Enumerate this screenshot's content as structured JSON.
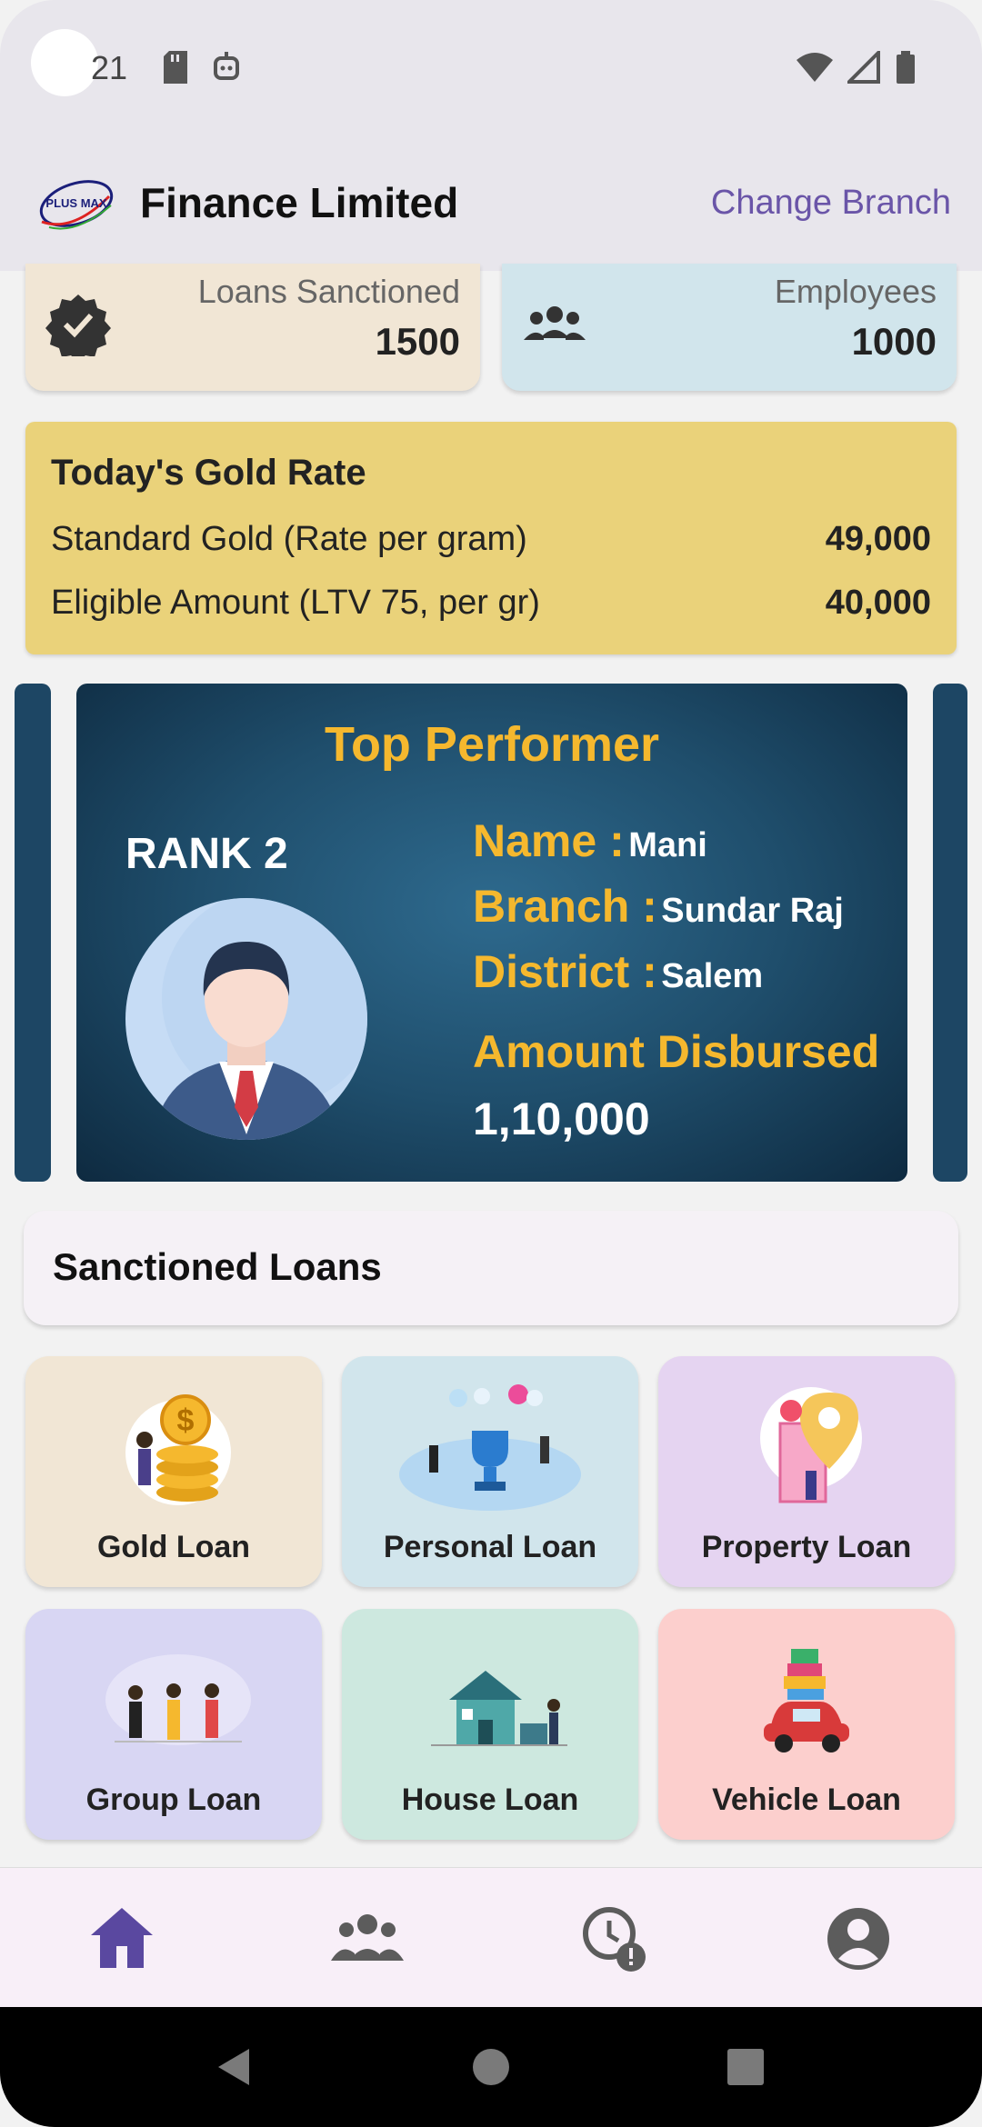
{
  "status_bar": {
    "time": "21"
  },
  "app_bar": {
    "title": "Finance Limited",
    "logo_text": "PLUS MAX",
    "change_branch": "Change Branch"
  },
  "stats": [
    {
      "label": "Loans Sanctioned",
      "value": "1500",
      "icon": "verified-badge-icon"
    },
    {
      "label": "Employees",
      "value": "1000",
      "icon": "group-icon"
    }
  ],
  "gold_rate": {
    "title": "Today's Gold Rate",
    "rows": [
      {
        "label": "Standard Gold (Rate per gram)",
        "value": "49,000"
      },
      {
        "label": "Eligible Amount (LTV 75, per gr)",
        "value": "40,000"
      }
    ]
  },
  "performer": {
    "title": "Top Performer",
    "rank": "RANK 2",
    "name_key": "Name :",
    "name": "Mani",
    "branch_key": "Branch :",
    "branch": "Sundar Raj",
    "district_key": "District :",
    "district": "Salem",
    "amount_label": "Amount Disbursed",
    "amount": "1,10,000"
  },
  "sanctioned_header": "Sanctioned Loans",
  "loans": [
    {
      "label": "Gold Loan",
      "bg": "#f1e6d5"
    },
    {
      "label": "Personal Loan",
      "bg": "#d1e5ec"
    },
    {
      "label": "Property Loan",
      "bg": "#e5d4f1"
    },
    {
      "label": "Group Loan",
      "bg": "#d8d6f3"
    },
    {
      "label": "House Loan",
      "bg": "#cde8df"
    },
    {
      "label": "Vehicle Loan",
      "bg": "#fccfcd"
    }
  ],
  "bottom_nav": [
    "home-icon",
    "people-icon",
    "pending-clock-icon",
    "account-icon"
  ],
  "colors": {
    "accent": "#6a55a8",
    "gold": "#f5b82e",
    "gold_card": "#ead27a"
  }
}
